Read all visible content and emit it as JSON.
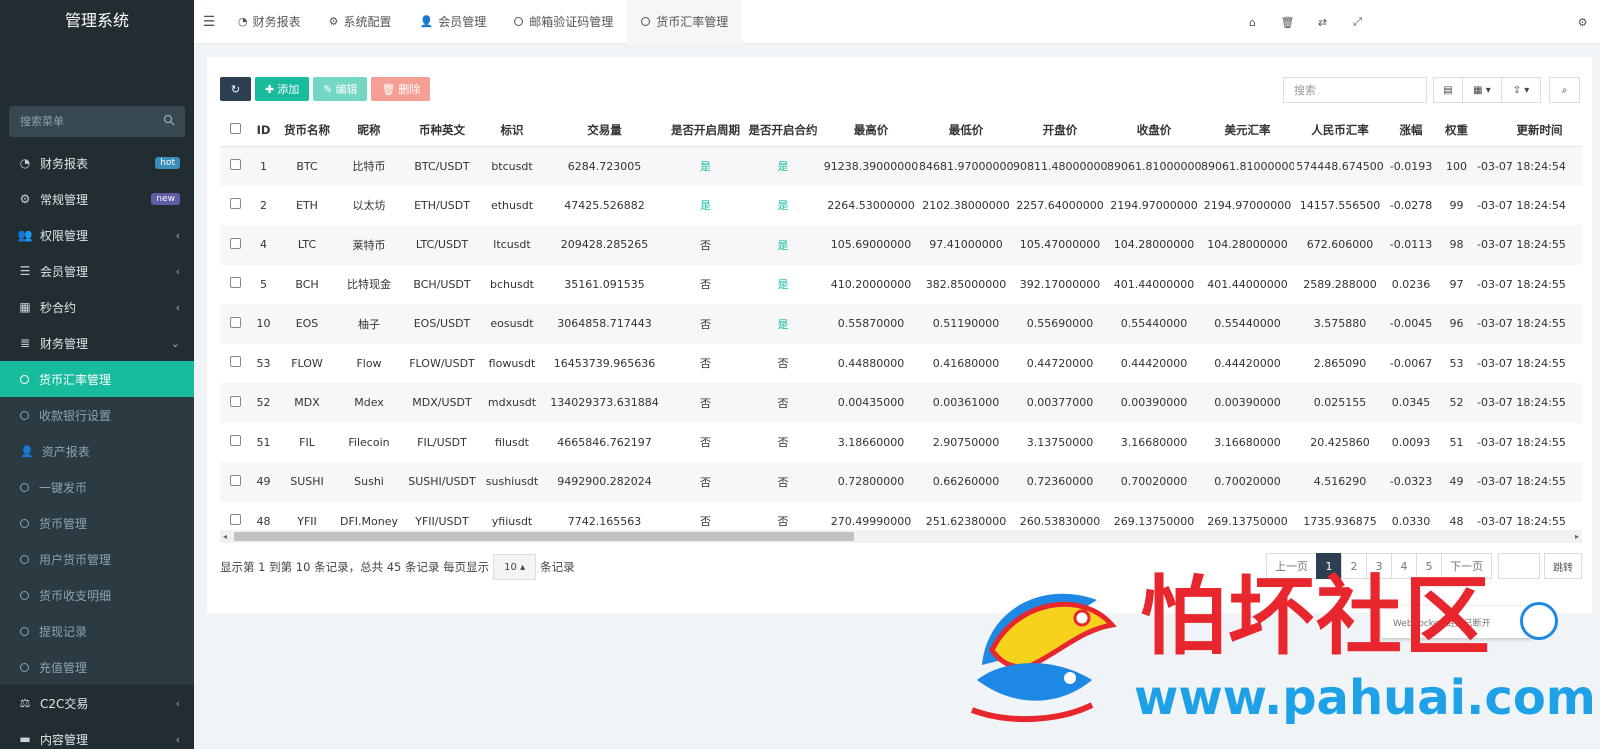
{
  "sidebar": {
    "title": "管理系统",
    "search_placeholder": "搜索菜单",
    "items_top": [
      {
        "label": "财务报表",
        "badge": "hot"
      },
      {
        "label": "常规管理",
        "badge": "new"
      },
      {
        "label": "权限管理"
      },
      {
        "label": "会员管理"
      },
      {
        "label": "秒合约"
      },
      {
        "label": "财务管理"
      }
    ],
    "submenu": [
      {
        "label": "货币汇率管理",
        "active": true
      },
      {
        "label": "收款银行设置"
      },
      {
        "label": "资产报表"
      },
      {
        "label": "一键发币"
      },
      {
        "label": "货币管理"
      },
      {
        "label": "用户货币管理"
      },
      {
        "label": "货币收支明细"
      },
      {
        "label": "提现记录"
      },
      {
        "label": "充值管理"
      }
    ],
    "items_bottom": [
      {
        "label": "C2C交易"
      },
      {
        "label": "内容管理"
      }
    ]
  },
  "header": {
    "tabs": [
      {
        "label": "财务报表"
      },
      {
        "label": "系统配置"
      },
      {
        "label": "会员管理"
      },
      {
        "label": "邮箱验证码管理"
      },
      {
        "label": "货币汇率管理"
      }
    ]
  },
  "toolbar": {
    "add_label": "添加",
    "edit_label": "编辑",
    "delete_label": "删除",
    "search_placeholder": "搜索"
  },
  "table": {
    "columns": [
      "ID",
      "货币名称",
      "昵称",
      "币种英文",
      "标识",
      "交易量",
      "是否开启周期",
      "是否开启合约",
      "最高价",
      "最低价",
      "开盘价",
      "收盘价",
      "美元汇率",
      "人民币汇率",
      "涨幅",
      "权重",
      "更新时间"
    ],
    "rows": [
      [
        "1",
        "BTC",
        "比特币",
        "BTC/USDT",
        "btcusdt",
        "6284.723005",
        "是",
        "是",
        "91238.39000000",
        "84681.97000000",
        "90811.48000000",
        "89061.81000000",
        "89061.81000000",
        "574448.674500",
        "-0.0193",
        "100",
        "-03-07 18:24:54"
      ],
      [
        "2",
        "ETH",
        "以太坊",
        "ETH/USDT",
        "ethusdt",
        "47425.526882",
        "是",
        "是",
        "2264.53000000",
        "2102.38000000",
        "2257.64000000",
        "2194.97000000",
        "2194.97000000",
        "14157.556500",
        "-0.0278",
        "99",
        "-03-07 18:24:54"
      ],
      [
        "4",
        "LTC",
        "莱特币",
        "LTC/USDT",
        "ltcusdt",
        "209428.285265",
        "否",
        "是",
        "105.69000000",
        "97.41000000",
        "105.47000000",
        "104.28000000",
        "104.28000000",
        "672.606000",
        "-0.0113",
        "98",
        "-03-07 18:24:55"
      ],
      [
        "5",
        "BCH",
        "比特现金",
        "BCH/USDT",
        "bchusdt",
        "35161.091535",
        "否",
        "是",
        "410.20000000",
        "382.85000000",
        "392.17000000",
        "401.44000000",
        "401.44000000",
        "2589.288000",
        "0.0236",
        "97",
        "-03-07 18:24:55"
      ],
      [
        "10",
        "EOS",
        "柚子",
        "EOS/USDT",
        "eosusdt",
        "3064858.717443",
        "否",
        "是",
        "0.55870000",
        "0.51190000",
        "0.55690000",
        "0.55440000",
        "0.55440000",
        "3.575880",
        "-0.0045",
        "96",
        "-03-07 18:24:55"
      ],
      [
        "53",
        "FLOW",
        "Flow",
        "FLOW/USDT",
        "flowusdt",
        "16453739.965636",
        "否",
        "否",
        "0.44880000",
        "0.41680000",
        "0.44720000",
        "0.44420000",
        "0.44420000",
        "2.865090",
        "-0.0067",
        "53",
        "-03-07 18:24:55"
      ],
      [
        "52",
        "MDX",
        "Mdex",
        "MDX/USDT",
        "mdxusdt",
        "134029373.631884",
        "否",
        "否",
        "0.00435000",
        "0.00361000",
        "0.00377000",
        "0.00390000",
        "0.00390000",
        "0.025155",
        "0.0345",
        "52",
        "-03-07 18:24:55"
      ],
      [
        "51",
        "FIL",
        "Filecoin",
        "FIL/USDT",
        "filusdt",
        "4665846.762197",
        "否",
        "否",
        "3.18660000",
        "2.90750000",
        "3.13750000",
        "3.16680000",
        "3.16680000",
        "20.425860",
        "0.0093",
        "51",
        "-03-07 18:24:55"
      ],
      [
        "49",
        "SUSHI",
        "Sushi",
        "SUSHI/USDT",
        "sushiusdt",
        "9492900.282024",
        "否",
        "否",
        "0.72800000",
        "0.66260000",
        "0.72360000",
        "0.70020000",
        "0.70020000",
        "4.516290",
        "-0.0323",
        "49",
        "-03-07 18:24:55"
      ],
      [
        "48",
        "YFII",
        "DFI.Money",
        "YFII/USDT",
        "yfiiusdt",
        "7742.165563",
        "否",
        "否",
        "270.49990000",
        "251.62380000",
        "260.53830000",
        "269.13750000",
        "269.13750000",
        "1735.936875",
        "0.0330",
        "48",
        "-03-07 18:24:55"
      ]
    ]
  },
  "footer": {
    "summary": "显示第 1 到第 10 条记录，总共 45 条记录 每页显示",
    "page_size": "10",
    "records_suffix": "条记录",
    "prev": "上一页",
    "pages": [
      "1",
      "2",
      "3",
      "4",
      "5"
    ],
    "next": "下一页",
    "go": "跳转"
  },
  "toast": {
    "text": "WebSocket 链接已断开"
  },
  "watermark": {
    "title": "怕坏社区",
    "url": "www.pahuai.com"
  },
  "colors": {
    "sidebar_bg": "#222d32",
    "accent": "#18bc9c",
    "primary_dark": "#2c3e50",
    "danger": "#f49e94",
    "watermark_red": "#e8262e",
    "watermark_blue": "#1ea1e6"
  }
}
